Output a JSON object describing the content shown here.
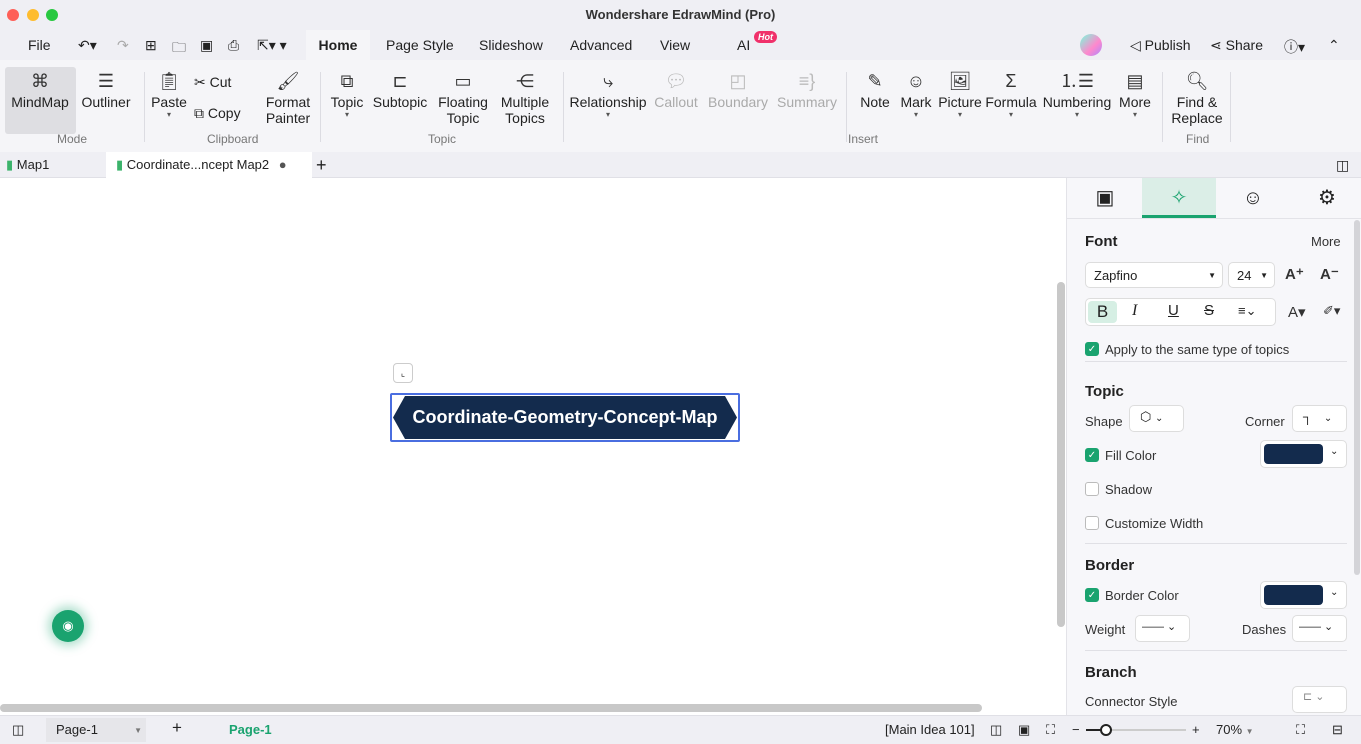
{
  "window": {
    "title": "Wondershare EdrawMind (Pro)"
  },
  "menu": {
    "file": "File",
    "tabs": [
      "Home",
      "Page Style",
      "Slideshow",
      "Advanced",
      "View",
      "AI"
    ],
    "ai_badge": "Hot",
    "publish": "Publish",
    "share": "Share"
  },
  "ribbon": {
    "mode": {
      "label": "Mode",
      "mindmap": "MindMap",
      "outliner": "Outliner"
    },
    "clipboard": {
      "label": "Clipboard",
      "paste": "Paste",
      "cut": "Cut",
      "copy": "Copy",
      "format_painter_1": "Format",
      "format_painter_2": "Painter"
    },
    "topic": {
      "label": "Topic",
      "topic": "Topic",
      "subtopic": "Subtopic",
      "floating_1": "Floating",
      "floating_2": "Topic",
      "multiple_1": "Multiple",
      "multiple_2": "Topics"
    },
    "insert": {
      "label": "Insert",
      "relationship": "Relationship",
      "callout": "Callout",
      "boundary": "Boundary",
      "summary": "Summary",
      "note": "Note",
      "mark": "Mark",
      "picture": "Picture",
      "formula": "Formula",
      "numbering": "Numbering",
      "more": "More"
    },
    "find": {
      "label": "Find",
      "find_1": "Find &",
      "find_2": "Replace"
    }
  },
  "doc_tabs": [
    {
      "label": "Map1"
    },
    {
      "label": "Coordinate...ncept Map2",
      "unsaved": true
    }
  ],
  "canvas": {
    "central_topic": "Coordinate-Geometry-Concept-Map",
    "topic_fill": "#132b4d"
  },
  "panel": {
    "font": {
      "title": "Font",
      "more": "More",
      "family": "Zapfino",
      "size": "24",
      "apply_same": "Apply to the same type of topics",
      "apply_checked": true,
      "bold_active": true
    },
    "topic": {
      "title": "Topic",
      "shape": "Shape",
      "corner": "Corner",
      "fill_color": "Fill Color",
      "fill_checked": true,
      "fill": "#132b4d",
      "shadow": "Shadow",
      "shadow_checked": false,
      "customize_width": "Customize Width",
      "width_checked": false
    },
    "border": {
      "title": "Border",
      "border_color": "Border Color",
      "border_checked": true,
      "color": "#132b4d",
      "weight": "Weight",
      "dashes": "Dashes"
    },
    "branch": {
      "title": "Branch",
      "connector_style": "Connector Style"
    }
  },
  "status": {
    "page_select": "Page-1",
    "page_tab": "Page-1",
    "selection": "[Main Idea 101]",
    "zoom": "70%",
    "zoom_value": 70
  },
  "colors": {
    "accent": "#1aa36f"
  }
}
